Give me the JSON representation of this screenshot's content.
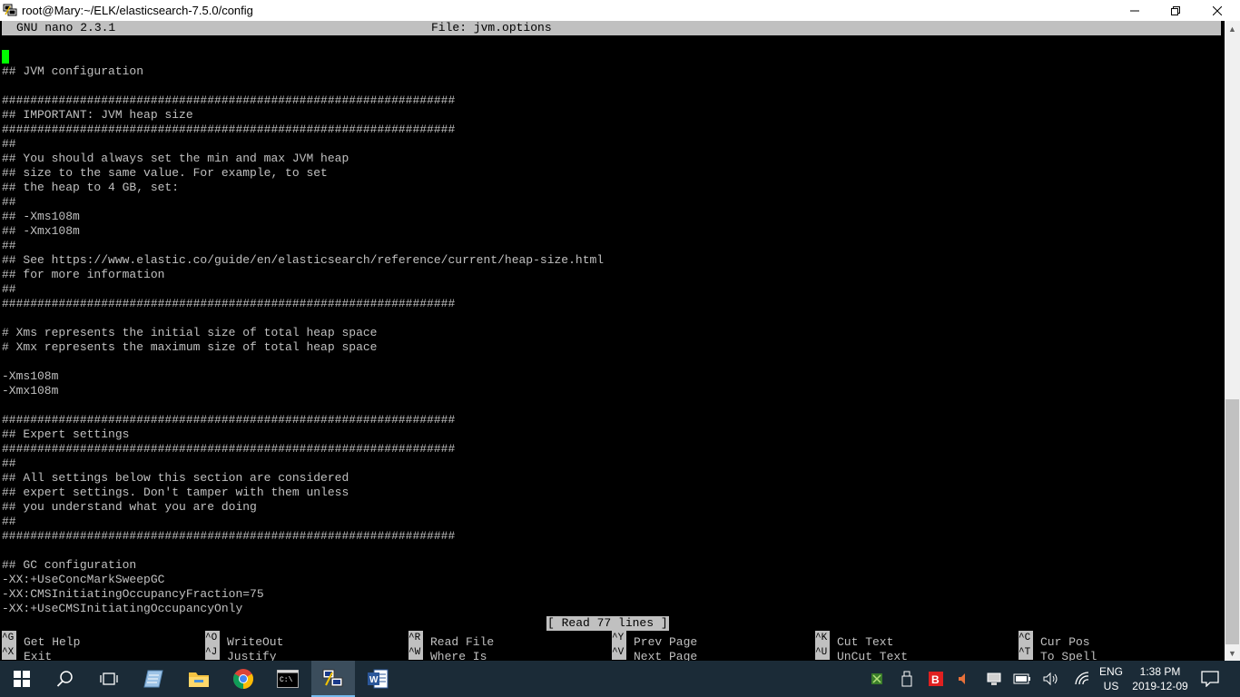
{
  "window": {
    "title": "root@Mary:~/ELK/elasticsearch-7.5.0/config",
    "buttons": {
      "minimize": "—",
      "maximize": "❐",
      "close": "✕"
    }
  },
  "nano": {
    "version": "GNU nano 2.3.1",
    "file": "File: jvm.options",
    "status": "[ Read 77 lines ]",
    "lines": [
      "",
      "## JVM configuration",
      "",
      "################################################################",
      "## IMPORTANT: JVM heap size",
      "################################################################",
      "##",
      "## You should always set the min and max JVM heap",
      "## size to the same value. For example, to set",
      "## the heap to 4 GB, set:",
      "##",
      "## -Xms108m",
      "## -Xmx108m",
      "##",
      "## See https://www.elastic.co/guide/en/elasticsearch/reference/current/heap-size.html",
      "## for more information",
      "##",
      "################################################################",
      "",
      "# Xms represents the initial size of total heap space",
      "# Xmx represents the maximum size of total heap space",
      "",
      "-Xms108m",
      "-Xmx108m",
      "",
      "################################################################",
      "## Expert settings",
      "################################################################",
      "##",
      "## All settings below this section are considered",
      "## expert settings. Don't tamper with them unless",
      "## you understand what you are doing",
      "##",
      "################################################################",
      "",
      "## GC configuration",
      "-XX:+UseConcMarkSweepGC",
      "-XX:CMSInitiatingOccupancyFraction=75",
      "-XX:+UseCMSInitiatingOccupancyOnly"
    ],
    "shortcuts": [
      [
        {
          "key": "^G",
          "label": "Get Help"
        },
        {
          "key": "^X",
          "label": "Exit"
        }
      ],
      [
        {
          "key": "^O",
          "label": "WriteOut"
        },
        {
          "key": "^J",
          "label": "Justify"
        }
      ],
      [
        {
          "key": "^R",
          "label": "Read File"
        },
        {
          "key": "^W",
          "label": "Where Is"
        }
      ],
      [
        {
          "key": "^Y",
          "label": "Prev Page"
        },
        {
          "key": "^V",
          "label": "Next Page"
        }
      ],
      [
        {
          "key": "^K",
          "label": "Cut Text"
        },
        {
          "key": "^U",
          "label": "UnCut Text"
        }
      ],
      [
        {
          "key": "^C",
          "label": "Cur Pos"
        },
        {
          "key": "^T",
          "label": "To Spell"
        }
      ]
    ]
  },
  "taskbar": {
    "apps": [
      "start-icon",
      "search-icon",
      "task-view-icon",
      "notepad-icon",
      "file-explorer-icon",
      "chrome-icon",
      "cmd-icon",
      "putty-icon",
      "word-icon"
    ],
    "word_label": "W",
    "language": {
      "lang": "ENG",
      "region": "US"
    },
    "clock": {
      "time": "1:38 PM",
      "date": "2019-12-09"
    },
    "colors": {
      "taskbar": "#1b2b37",
      "accent": "#76b9ed",
      "cursor": "#00ff00"
    }
  }
}
